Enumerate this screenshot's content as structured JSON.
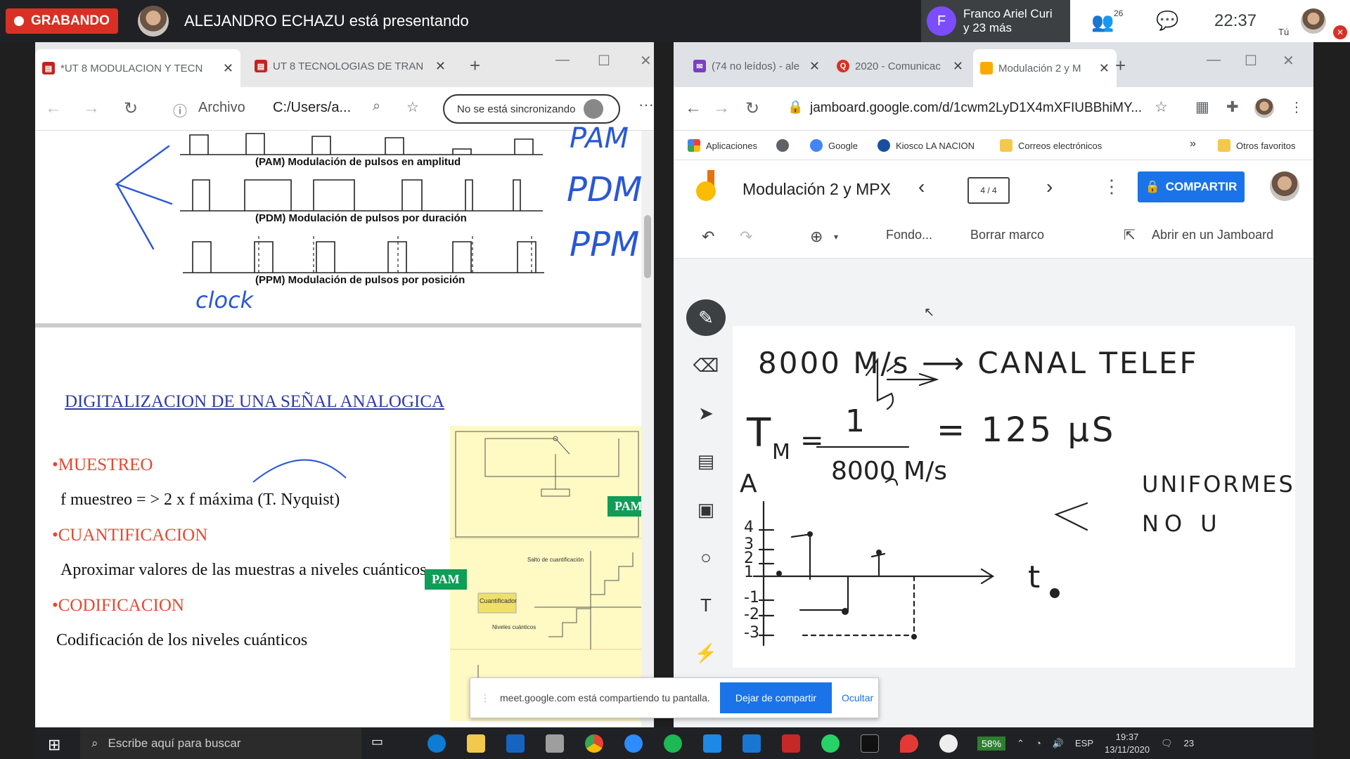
{
  "meet": {
    "recording_label": "GRABANDO",
    "presenting_text": "ALEJANDRO ECHAZU está presentando",
    "participant_initial": "F",
    "participant_name": "Franco Ariel Curi",
    "participant_more": "y 23 más",
    "people_count": "26",
    "time": "22:37",
    "self_label": "Tú"
  },
  "edge": {
    "tabs": [
      {
        "label": "*UT 8 MODULACION Y TECN"
      },
      {
        "label": "UT 8 TECNOLOGIAS DE TRAN"
      }
    ],
    "address_scheme": "Archivo",
    "address_path": "C:/Users/a...",
    "sync_status": "No se está sincronizando",
    "doc": {
      "captions": {
        "pam": "(PAM) Modulación de pulsos en amplitud",
        "pdm": "(PDM) Modulación de pulsos por duración",
        "ppm": "(PPM) Modulación de pulsos por posición"
      },
      "hand": {
        "pam": "PAM",
        "pdm": "PDM",
        "ppm": "PPM",
        "clock": "clock"
      },
      "slide_title": "DIGITALIZACION DE UNA SEÑAL ANALOGICA",
      "bullets": [
        {
          "head": "•MUESTREO",
          "text": "f muestreo = > 2 x f máxima (T. Nyquist)"
        },
        {
          "head": "•CUANTIFICACION",
          "text": "Aproximar valores de las muestras a niveles cuánticos."
        },
        {
          "head": "•CODIFICACION",
          "text": "Codificación de los niveles cuánticos"
        }
      ],
      "badges": {
        "pam1": "PAM",
        "pam2": "PAM"
      },
      "fig_labels": {
        "cuantificador": "Cuantificador",
        "niveles": "Niveles cuánticos",
        "salto": "Salto de cuantificación"
      }
    }
  },
  "chrome": {
    "tabs": [
      {
        "label": "(74 no leídos) - ale"
      },
      {
        "label": "2020 - Comunicac"
      },
      {
        "label": "Modulación 2 y M"
      }
    ],
    "url": "jamboard.google.com/d/1cwm2LyD1X4mXFIUBBhiMY...",
    "bookmarks": [
      "Aplicaciones",
      "Google",
      "Kiosco LA NACION",
      "Correos electrónicos",
      "Otros favoritos"
    ],
    "jamboard": {
      "title": "Modulación 2 y MPX",
      "frame_indicator": "4 / 4",
      "share_label": "COMPARTIR",
      "tools": {
        "fondo": "Fondo...",
        "borrar": "Borrar marco",
        "abrir": "Abrir en un Jamboard"
      },
      "ink": {
        "line1": "8000 M/s ⟶ CANAL TELEF",
        "line2": "T",
        "line2_sub": "M",
        "frac_top": "1",
        "frac_bottom": "8000 M/s",
        "result": "= 125 μS",
        "uniformes": "UNIFORMES",
        "no_u": "NO U",
        "axis_a": "A",
        "axis_t": "t",
        "yticks": [
          "4",
          "3",
          "2",
          "1",
          "-1",
          "-2",
          "-3"
        ]
      }
    }
  },
  "share_notice": {
    "text": "meet.google.com está compartiendo tu pantalla.",
    "stop": "Dejar de compartir",
    "hide": "Ocultar"
  },
  "taskbar": {
    "search_placeholder": "Escribe aquí para buscar",
    "battery": "58%",
    "lang": "ESP",
    "time": "19:37",
    "date": "13/11/2020",
    "notifications": "23"
  }
}
